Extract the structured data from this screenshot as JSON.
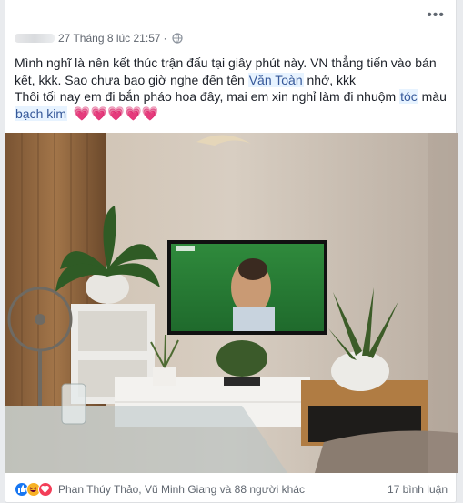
{
  "post": {
    "timestamp": "27 Tháng 8 lúc 21:57",
    "separator": "·",
    "privacy_icon": "globe-icon",
    "more_icon": "more-options-icon",
    "text": {
      "line1": "Mình nghĩ là nên kết thúc trận đấu tại giây phút này. VN thẳng tiến vào bán kết, kkk. Sao chưa bao giờ nghe đến tên",
      "tag_name": "Văn Toàn",
      "line2_rest": " nhở, kkk",
      "line3_start": "Thôi tối nay em đi bắn pháo hoa đây, mai em xin nghỉ làm đi nhuộm",
      "tag_hair": "tóc",
      "line3_mid": " màu",
      "tag_color": "bạch kim",
      "hearts": "💗💗💗💗💗"
    }
  },
  "footer": {
    "reaction_icons": [
      "like-reaction-icon",
      "haha-reaction-icon",
      "love-reaction-icon"
    ],
    "likers": "Phan Thúy Thảo, Vũ Minh Giang và 88 người khác",
    "comments": "17 bình luận"
  },
  "colors": {
    "link": "#365899",
    "tag_bg": "#e7f3ff",
    "heart": "#f25268",
    "like": "#1877f2",
    "love": "#f33e58",
    "haha": "#f7b125"
  }
}
